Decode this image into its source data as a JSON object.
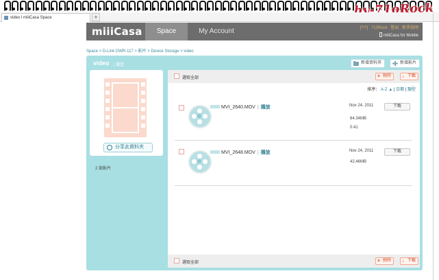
{
  "watermark": "by-71oRock",
  "browser": {
    "tab_title": "video l miiiCasa Space",
    "newtab_label": "+"
  },
  "header": {
    "logo": "miiiCasa",
    "nav_space": "Space",
    "nav_account": "My Account",
    "link_user": "[?/?]",
    "link_name": "710Rock",
    "link_logout": "登出",
    "link_help": "新手說明",
    "mobile_label": "miiiCasa for Mobile"
  },
  "breadcrumb": "Space > D-Link DWR-117 > 影片 > Device Storage > video",
  "main": {
    "title": "video",
    "settings": "| 設定",
    "btn_new_folder": "新增資料夾",
    "btn_new_video": "新增影片"
  },
  "left": {
    "share_label": "分享此資料夾",
    "video_count": "2 部影片"
  },
  "toolbar": {
    "select_all": "選取全部",
    "delete": "刪除",
    "download": "下載"
  },
  "sort": {
    "label": "排序：",
    "az": "A-Z ▲",
    "date": "日期",
    "type": "類型",
    "sep": "|"
  },
  "files": [
    {
      "name": "MVI_2640.MOV",
      "play": "播放",
      "date": "Nov 24, 2011",
      "size": "64.34MB",
      "duration": "0:41",
      "download": "下載"
    },
    {
      "name": "MVI_2648.MOV",
      "play": "播放",
      "date": "Nov 24, 2011",
      "size": "42.46MB",
      "download": "下載"
    }
  ],
  "colors": {
    "header_bg": "#6d6d6d",
    "panel_bg": "#a8dfe3",
    "accent": "#2d7f93",
    "watermark": "#c0182a",
    "film_icon": "#fbd9cc"
  },
  "icons": [
    "new-folder-icon",
    "new-video-icon",
    "share-icon",
    "film-icon",
    "film-reel-icon",
    "delete-icon",
    "download-icon",
    "mobile-icon"
  ]
}
